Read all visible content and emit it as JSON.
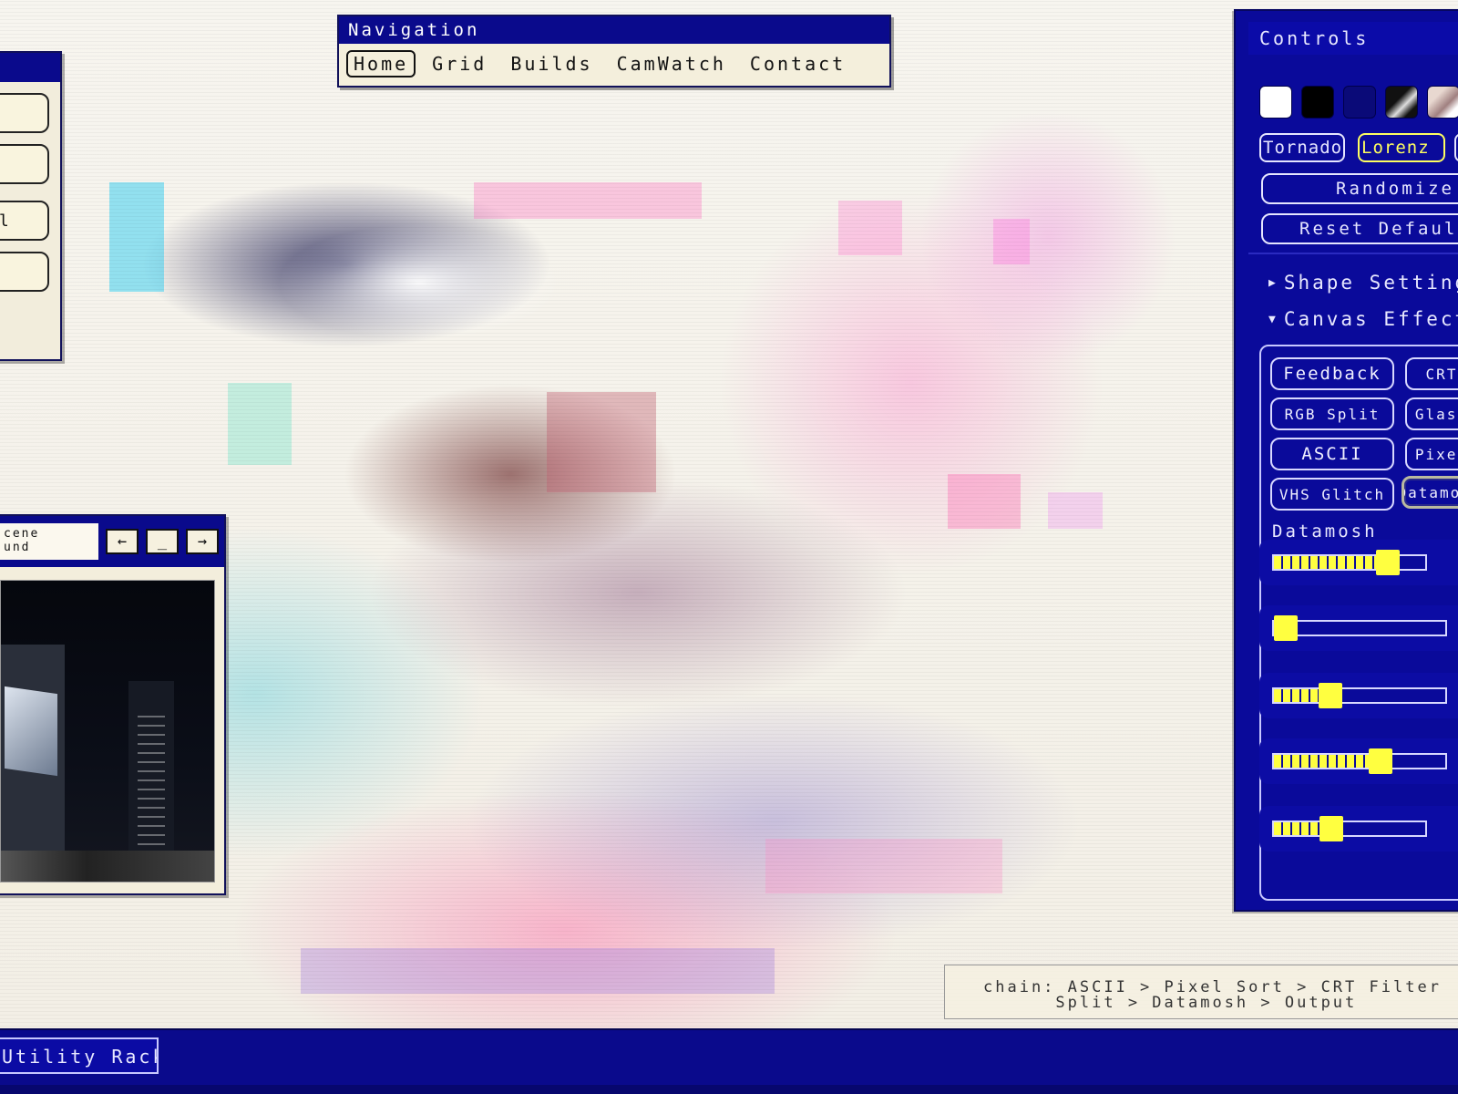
{
  "navigation": {
    "title": "Navigation",
    "links": [
      "Home",
      "Grid",
      "Builds",
      "CamWatch",
      "Contact"
    ],
    "active": "Home"
  },
  "left_window": {
    "buttons": [
      "",
      "",
      "al",
      ""
    ]
  },
  "camera_window": {
    "scene_label": "cene\nund",
    "prev_icon": "←",
    "minimize_icon": "_",
    "next_icon": "→"
  },
  "controls": {
    "title": "Controls",
    "swatches": [
      "#ffffff",
      "#000000",
      "#0a0a78",
      "#222222",
      "#d8c8c0"
    ],
    "presets": [
      {
        "label": "Tornado",
        "active": false
      },
      {
        "label": "Lorenz",
        "active": true
      },
      {
        "label": "E",
        "active": false
      }
    ],
    "randomize_label": "Randomize",
    "reset_label": "Reset Defaults",
    "sections": [
      {
        "label": "Shape Settings",
        "expanded": false
      },
      {
        "label": "Canvas Effects",
        "expanded": true
      }
    ],
    "effects": [
      [
        "Feedback",
        "CRT"
      ],
      [
        "RGB Split",
        "Glass"
      ],
      [
        "ASCII",
        "Pixel"
      ],
      [
        "VHS Glitch",
        "Datamosh"
      ]
    ],
    "selected_effect": "Datamosh",
    "effect_param_label": "Datamosh",
    "slider_values": [
      0.75,
      0.06,
      0.33,
      0.62,
      0.38
    ],
    "accent_color": "#ffff40",
    "panel_color": "#0a0a9a"
  },
  "chain": {
    "text": "chain: ASCII > Pixel Sort > CRT Filter\n      Split > Datamosh > Output"
  },
  "taskbar": {
    "tab_label": "Utility Rack"
  }
}
